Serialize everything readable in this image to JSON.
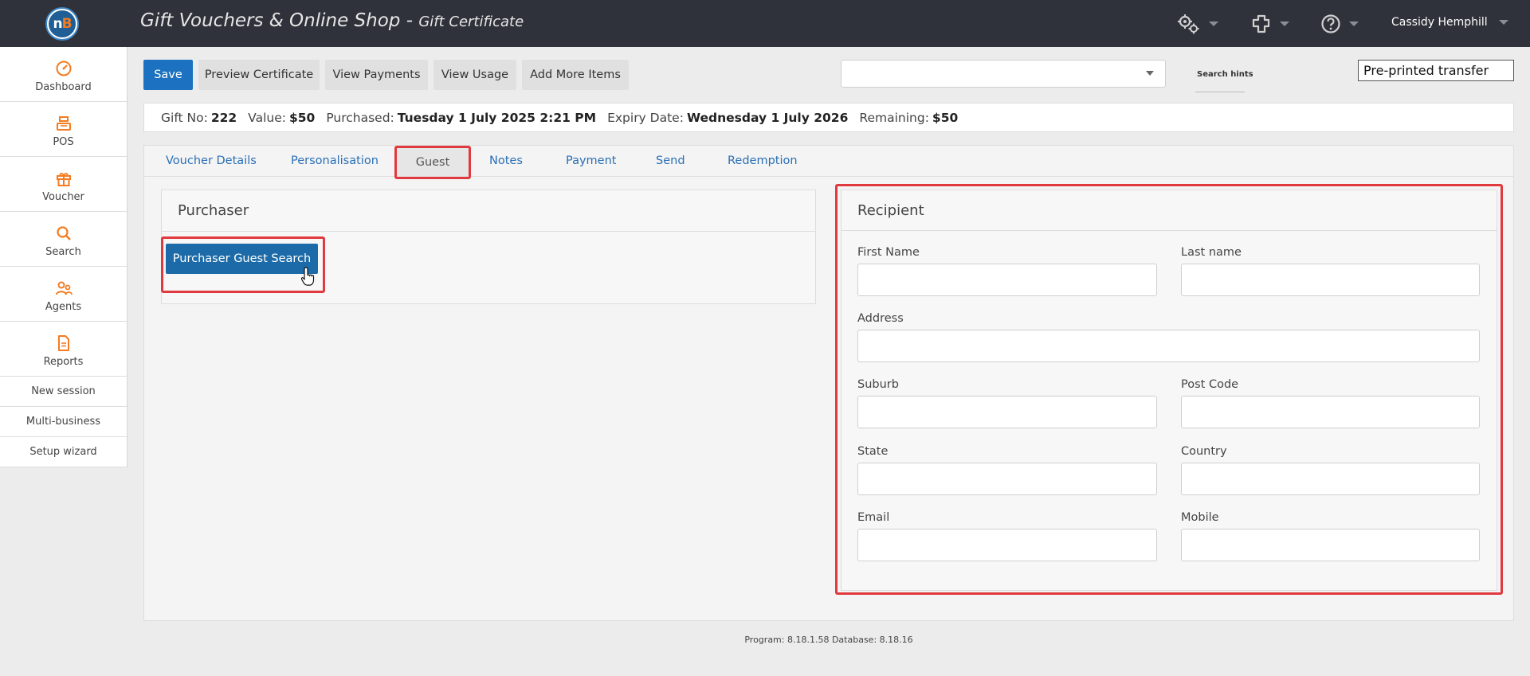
{
  "header": {
    "title": "Gift Vouchers & Online Shop -",
    "subtitle": "Gift Certificate",
    "user_name": "Cassidy Hemphill"
  },
  "sidebar": {
    "items": [
      {
        "label": "Dashboard",
        "icon": "dashboard-gauge-icon"
      },
      {
        "label": "POS",
        "icon": "cash-register-icon"
      },
      {
        "label": "Voucher",
        "icon": "gift-icon"
      },
      {
        "label": "Search",
        "icon": "search-icon"
      },
      {
        "label": "Agents",
        "icon": "agents-icon"
      },
      {
        "label": "Reports",
        "icon": "document-icon"
      }
    ],
    "links": [
      "New session",
      "Multi-business",
      "Setup wizard"
    ]
  },
  "toolbar": {
    "save": "Save",
    "preview": "Preview Certificate",
    "view_payments": "View Payments",
    "view_usage": "View Usage",
    "add_more": "Add More Items",
    "search_hints": "Search hints",
    "transfer_value": "Pre-printed transfer"
  },
  "info": {
    "gift_no_label": "Gift No:",
    "gift_no": "222",
    "value_label": "Value:",
    "value": "$50",
    "purchased_label": "Purchased:",
    "purchased": "Tuesday 1 July 2025 2:21 PM",
    "expiry_label": "Expiry Date:",
    "expiry": "Wednesday 1 July 2026",
    "remaining_label": "Remaining:",
    "remaining": "$50"
  },
  "tabs": [
    "Voucher Details",
    "Personalisation",
    "Guest",
    "Notes",
    "Payment",
    "Send",
    "Redemption"
  ],
  "purchaser": {
    "title": "Purchaser",
    "button": "Purchaser Guest Search"
  },
  "recipient": {
    "title": "Recipient",
    "first_name": "First Name",
    "last_name": "Last name",
    "address": "Address",
    "suburb": "Suburb",
    "post_code": "Post Code",
    "state": "State",
    "country": "Country",
    "email": "Email",
    "mobile": "Mobile"
  },
  "footer": "Program: 8.18.1.58 Database: 8.18.16",
  "colors": {
    "topbar": "#2f323a",
    "primary": "#1c72c0",
    "accent_orange": "#f47b20",
    "highlight_red": "#e0393e",
    "tab_link": "#2a6fb5"
  }
}
